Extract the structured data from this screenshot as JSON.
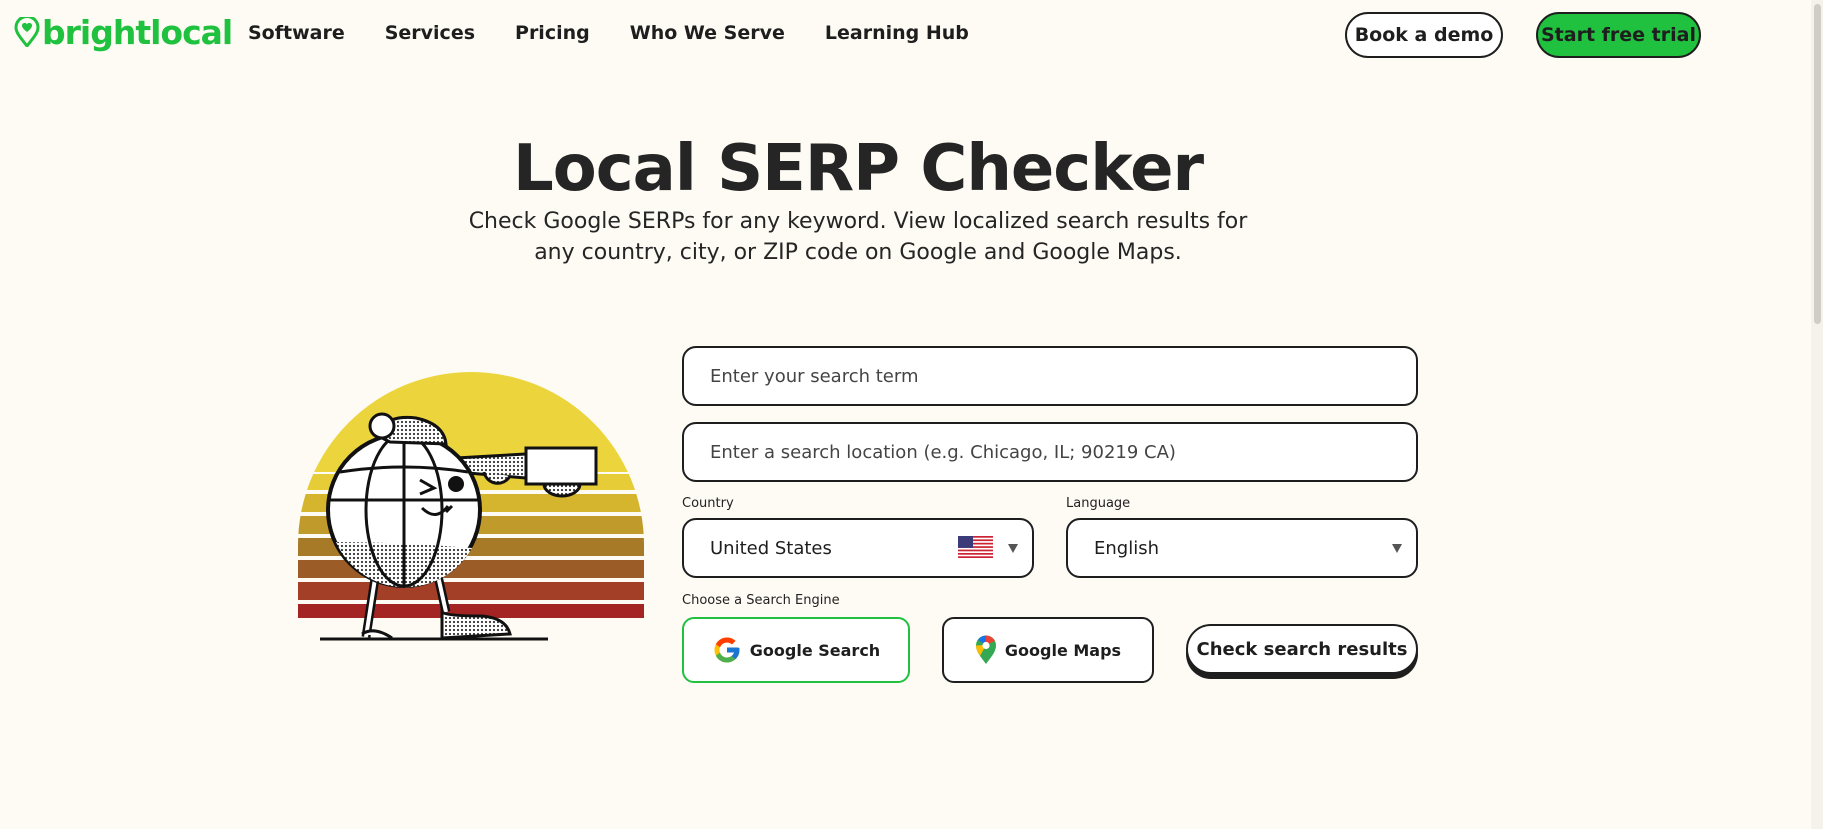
{
  "brand": {
    "name": "brightlocal",
    "color": "#1fc13f",
    "icon": "location-heart-pin-icon"
  },
  "nav": {
    "links": [
      "Software",
      "Services",
      "Pricing",
      "Who We Serve",
      "Learning Hub"
    ],
    "demo_label": "Book a demo",
    "trial_label": "Start free trial"
  },
  "hero": {
    "title": "Local SERP Checker",
    "subtitle": "Check Google SERPs for any keyword. View localized search results for any country, city, or ZIP code on Google and Google Maps."
  },
  "illustration": {
    "icon": "globe-character-with-telescope-icon"
  },
  "form": {
    "search_term": {
      "value": "",
      "placeholder": "Enter your search term"
    },
    "location": {
      "value": "",
      "placeholder": "Enter a search location (e.g. Chicago, IL; 90219 CA)"
    },
    "country": {
      "label": "Country",
      "value": "United States",
      "flag_icon": "us-flag-icon"
    },
    "language": {
      "label": "Language",
      "value": "English"
    },
    "engine": {
      "label": "Choose a Search Engine",
      "options": [
        "Google Search",
        "Google Maps"
      ],
      "selected": "Google Search"
    },
    "submit_label": "Check search results"
  }
}
